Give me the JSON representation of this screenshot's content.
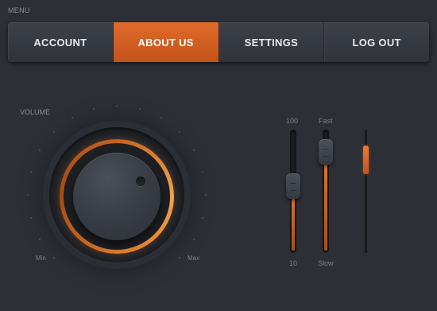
{
  "menu": {
    "label": "MENU",
    "items": [
      {
        "label": "ACCOUNT",
        "active": false
      },
      {
        "label": "ABOUT US",
        "active": true
      },
      {
        "label": "SETTINGS",
        "active": false
      },
      {
        "label": "LOG OUT",
        "active": false
      }
    ]
  },
  "volume": {
    "label": "VOLUME",
    "min_label": "Min",
    "max_label": "Max"
  },
  "sliders": [
    {
      "top_label": "100",
      "bottom_label": "10",
      "value_fraction": 0.55
    },
    {
      "top_label": "Fast",
      "bottom_label": "Slow",
      "value_fraction": 0.9
    },
    {
      "value_fraction": 0.83
    }
  ],
  "colors": {
    "accent": "#e06a2a",
    "background": "#2c2f35"
  }
}
